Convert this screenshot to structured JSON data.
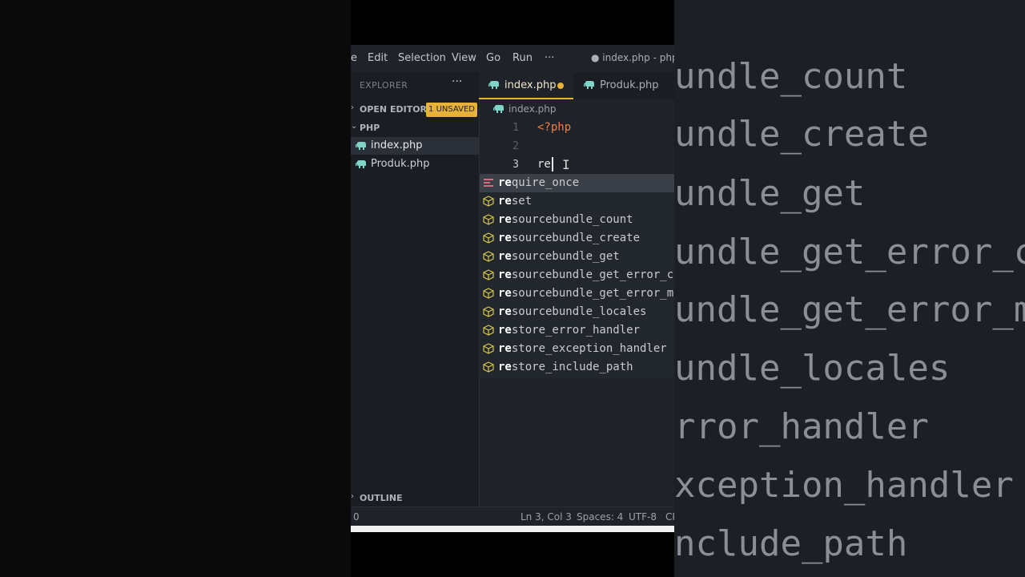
{
  "background_zoom": {
    "lines": [
      "undle_count",
      "undle_create",
      "undle_get",
      "undle_get_error_c",
      "undle_get_error_m",
      "undle_locales",
      "rror_handler",
      "xception_handler",
      "nclude_path"
    ]
  },
  "menubar": {
    "items": [
      "e",
      "Edit",
      "Selection",
      "View",
      "Go",
      "Run",
      "···"
    ],
    "title": "● index.php - php -"
  },
  "sidebar": {
    "explorer_label": "EXPLORER",
    "more": "···",
    "open_editors": {
      "chevron": "›",
      "label": "OPEN EDITORS",
      "badge": "1 UNSAVED"
    },
    "folder": {
      "chevron": "⌄",
      "label": "PHP"
    },
    "files": [
      "index.php",
      "Produk.php"
    ],
    "outline": {
      "chevron": "›",
      "label": "OUTLINE"
    }
  },
  "tabs": [
    {
      "label": "index.php",
      "modified": true,
      "active": true
    },
    {
      "label": "Produk.php",
      "modified": false,
      "active": false
    }
  ],
  "breadcrumb": "index.php",
  "editor": {
    "line_numbers": [
      "1",
      "2",
      "3"
    ],
    "lines": [
      "<?php",
      "",
      "re"
    ],
    "ibeam": "I"
  },
  "suggestions": {
    "prefix": "re",
    "items": [
      {
        "rest": "quire_once",
        "kind": "keyword"
      },
      {
        "rest": "set",
        "kind": "function"
      },
      {
        "rest": "sourcebundle_count",
        "kind": "function"
      },
      {
        "rest": "sourcebundle_create",
        "kind": "function"
      },
      {
        "rest": "sourcebundle_get",
        "kind": "function"
      },
      {
        "rest": "sourcebundle_get_error_c",
        "kind": "function"
      },
      {
        "rest": "sourcebundle_get_error_m",
        "kind": "function"
      },
      {
        "rest": "sourcebundle_locales",
        "kind": "function"
      },
      {
        "rest": "store_error_handler",
        "kind": "function"
      },
      {
        "rest": "store_exception_handler",
        "kind": "function"
      },
      {
        "rest": "store_include_path",
        "kind": "function"
      }
    ]
  },
  "statusbar": {
    "left": "0",
    "position": "Ln 3, Col 3",
    "spaces": "Spaces: 4",
    "encoding": "UTF-8",
    "eol": "CR"
  },
  "colors": {
    "accent": "#e6b23a",
    "php_tag": "#e8813f",
    "elephant": "#7fd6c8",
    "method_icon": "#d7c94a",
    "keyword_icon": "#d46a7a"
  }
}
